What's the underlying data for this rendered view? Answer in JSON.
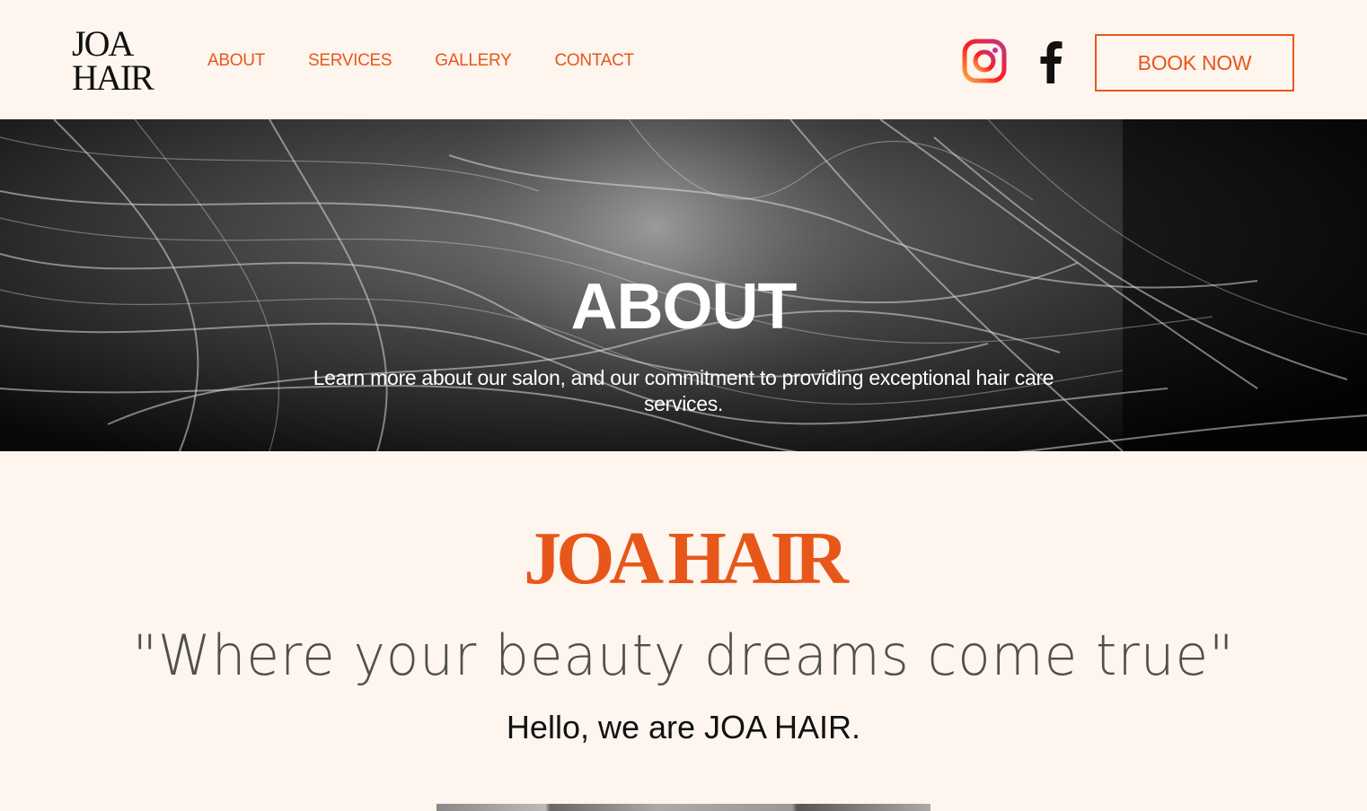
{
  "header": {
    "logo_line1": "JOA",
    "logo_line2": "HAIR",
    "nav": [
      {
        "label": "ABOUT"
      },
      {
        "label": "SERVICES"
      },
      {
        "label": "GALLERY"
      },
      {
        "label": "CONTACT"
      }
    ],
    "social_icons": [
      "instagram-icon",
      "facebook-icon"
    ],
    "book_label": "BOOK NOW"
  },
  "hero": {
    "title": "ABOUT",
    "subtitle": "Learn more about our salon, and our commitment to providing exceptional hair care services."
  },
  "intro": {
    "brand": "JOA HAIR",
    "tagline": "\"Where your beauty dreams come true\"",
    "greeting": "Hello, we are JOA HAIR."
  },
  "colors": {
    "accent": "#e8571a",
    "background": "#fdf5ee",
    "text_dark": "#111111"
  }
}
